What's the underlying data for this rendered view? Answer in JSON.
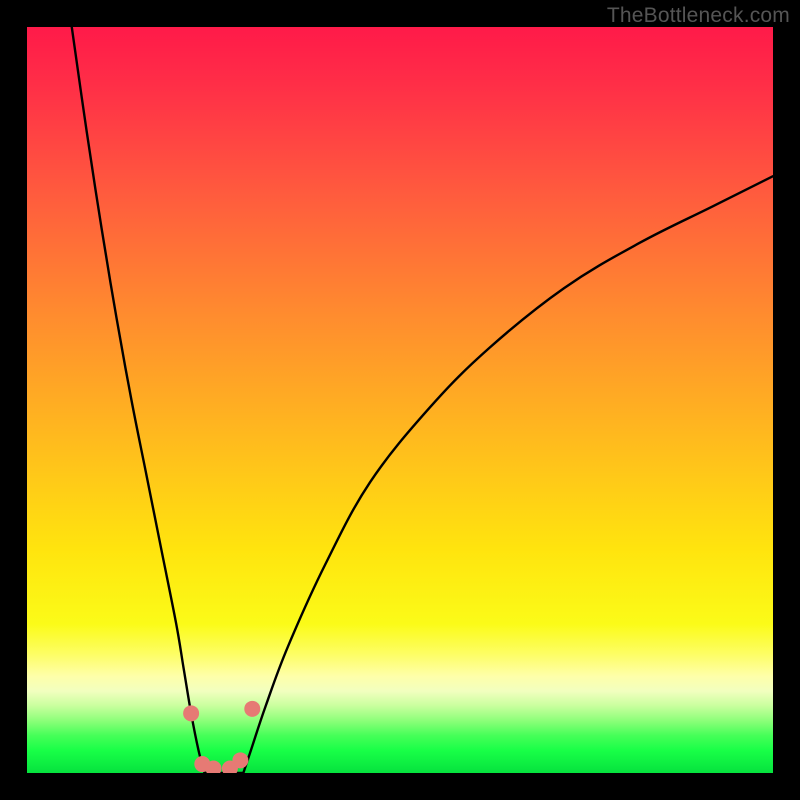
{
  "watermark": "TheBottleneck.com",
  "chart_data": {
    "type": "line",
    "title": "",
    "xlabel": "",
    "ylabel": "",
    "xlim": [
      0,
      100
    ],
    "ylim": [
      0,
      100
    ],
    "grid": false,
    "legend": false,
    "background": {
      "type": "vertical-gradient",
      "stops": [
        {
          "pos": 0,
          "color": "#ff1a49"
        },
        {
          "pos": 22,
          "color": "#ff5a3e"
        },
        {
          "pos": 54,
          "color": "#ffb71f"
        },
        {
          "pos": 80,
          "color": "#fbfb18"
        },
        {
          "pos": 90,
          "color": "#c9ff9e"
        },
        {
          "pos": 100,
          "color": "#06e23e"
        }
      ]
    },
    "series": [
      {
        "name": "left-branch",
        "color": "#000000",
        "x": [
          6,
          8,
          10,
          12,
          14,
          16,
          18,
          20,
          21,
          22,
          23,
          23.8
        ],
        "y": [
          100,
          86,
          73,
          61,
          50,
          40,
          30,
          20,
          14,
          8,
          3,
          0
        ]
      },
      {
        "name": "valley-floor",
        "color": "#000000",
        "x": [
          23.8,
          25,
          26,
          27,
          28,
          29
        ],
        "y": [
          0,
          0,
          0,
          0,
          0,
          0
        ]
      },
      {
        "name": "right-branch",
        "color": "#000000",
        "x": [
          29,
          30,
          32,
          35,
          40,
          46,
          54,
          62,
          72,
          82,
          92,
          100
        ],
        "y": [
          0,
          3,
          9,
          17,
          28,
          39,
          49,
          57,
          65,
          71,
          76,
          80
        ]
      }
    ],
    "markers": {
      "name": "valley-markers",
      "color": "#e67a74",
      "points": [
        {
          "x": 22.0,
          "y": 8.0
        },
        {
          "x": 23.5,
          "y": 1.2
        },
        {
          "x": 25.0,
          "y": 0.6
        },
        {
          "x": 27.2,
          "y": 0.6
        },
        {
          "x": 28.6,
          "y": 1.7
        },
        {
          "x": 30.2,
          "y": 8.6
        }
      ]
    }
  }
}
